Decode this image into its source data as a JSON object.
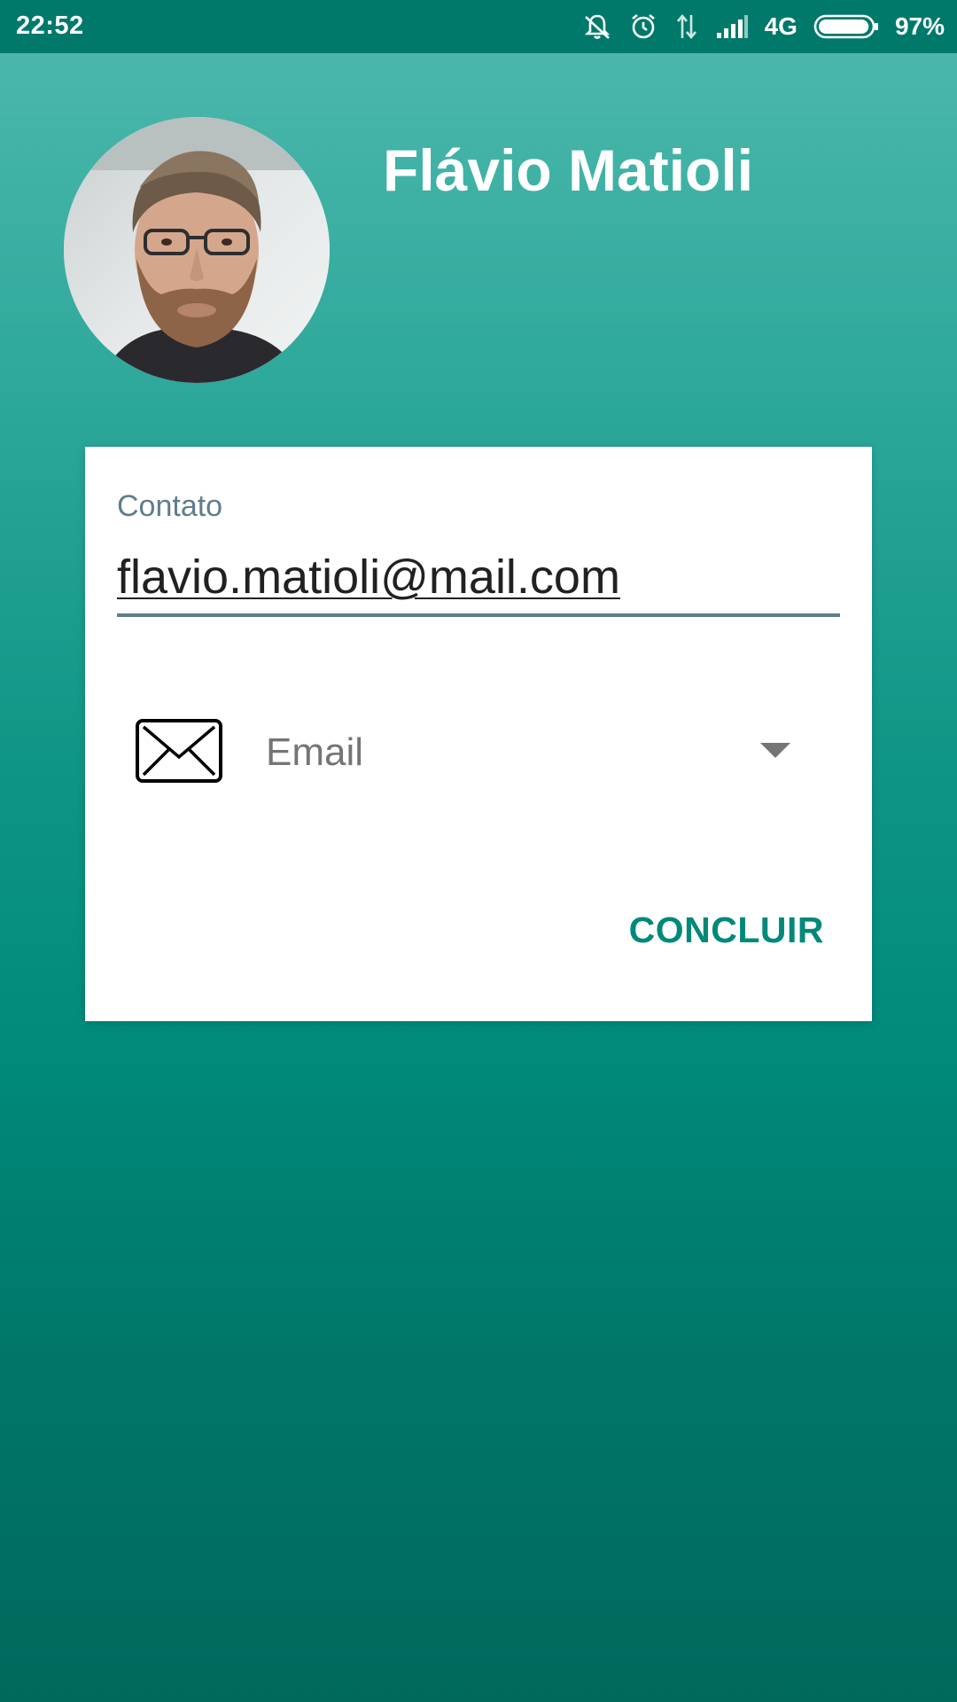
{
  "status_bar": {
    "time": "22:52",
    "network": "4G",
    "battery": "97%",
    "icons": [
      "bell-off-icon",
      "alarm-icon",
      "data-transfer-icon",
      "signal-icon",
      "battery-icon"
    ],
    "battery_level": 0.97
  },
  "profile": {
    "name": "Flávio Matioli",
    "avatar_icon": "avatar-photo"
  },
  "form": {
    "contact_label": "Contato",
    "contact_value": "flavio.matioli@mail.com",
    "contact_type": {
      "icon": "envelope-icon",
      "selected": "Email"
    },
    "done_label": "CONCLUIR"
  },
  "colors": {
    "status_bar": "#00796b",
    "accent": "#00897b",
    "label": "#607d8b",
    "input_text": "#212121",
    "select_text": "#757575"
  }
}
